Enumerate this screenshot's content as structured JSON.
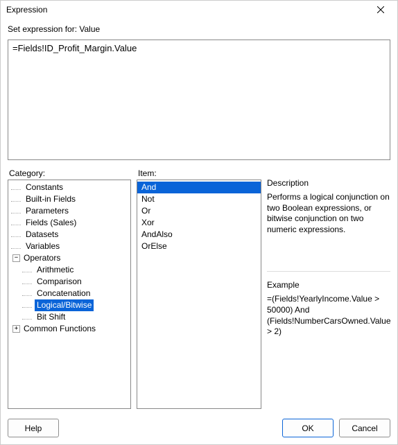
{
  "window": {
    "title": "Expression"
  },
  "prompt_prefix": "Set expression for: ",
  "prompt_target": "Value",
  "expression_text": "=Fields!ID_Profit_Margin.Value",
  "labels": {
    "category": "Category:",
    "item": "Item:",
    "description_heading": "Description",
    "example_heading": "Example"
  },
  "category_tree": {
    "nodes": [
      {
        "label": "Constants"
      },
      {
        "label": "Built-in Fields"
      },
      {
        "label": "Parameters"
      },
      {
        "label": "Fields (Sales)"
      },
      {
        "label": "Datasets"
      },
      {
        "label": "Variables"
      },
      {
        "label": "Operators",
        "expanded": true,
        "children": [
          {
            "label": "Arithmetic"
          },
          {
            "label": "Comparison"
          },
          {
            "label": "Concatenation"
          },
          {
            "label": "Logical/Bitwise",
            "selected": true
          },
          {
            "label": "Bit Shift"
          }
        ]
      },
      {
        "label": "Common Functions",
        "expanded": false,
        "children_placeholder": true
      }
    ]
  },
  "items": [
    {
      "label": "And",
      "selected": true
    },
    {
      "label": "Not"
    },
    {
      "label": "Or"
    },
    {
      "label": "Xor"
    },
    {
      "label": "AndAlso"
    },
    {
      "label": "OrElse"
    }
  ],
  "description_text": "Performs a logical conjunction on two Boolean expressions, or bitwise conjunction on two numeric expressions.",
  "example_text": "=(Fields!YearlyIncome.Value > 50000) And (Fields!NumberCarsOwned.Value > 2)",
  "buttons": {
    "help": "Help",
    "ok": "OK",
    "cancel": "Cancel"
  }
}
